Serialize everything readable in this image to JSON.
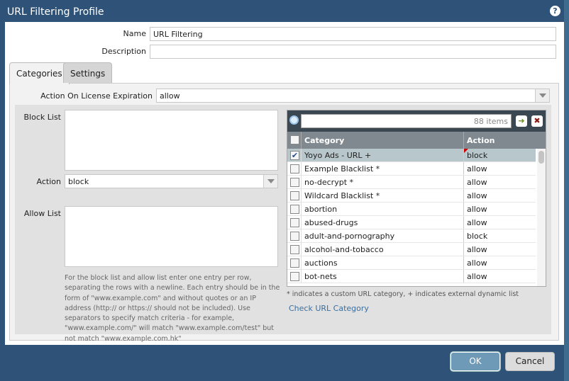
{
  "title": "URL Filtering Profile",
  "form": {
    "name_label": "Name",
    "name_value": "URL Filtering",
    "description_label": "Description",
    "description_value": ""
  },
  "tabs": [
    {
      "label": "Categories"
    },
    {
      "label": "Settings"
    }
  ],
  "license": {
    "label": "Action On License Expiration",
    "value": "allow"
  },
  "block_list": {
    "label": "Block List",
    "value": ""
  },
  "action": {
    "label": "Action",
    "value": "block"
  },
  "allow_list": {
    "label": "Allow List",
    "value": ""
  },
  "help_text": "For the block list and allow list enter one entry per row, separating the rows with a newline. Each entry should be in the form of \"www.example.com\" and without quotes or an IP address (http:// or https:// should not be included). Use separators to specify match criteria - for example, \"www.example.com/\" will match \"www.example.com/test\" but not match \"www.example.com.hk\"",
  "grid": {
    "count": "88 items",
    "col_category": "Category",
    "col_action": "Action",
    "rows": [
      {
        "category": "Yoyo Ads - URL +",
        "action": "block",
        "checked": true
      },
      {
        "category": "Example Blacklist *",
        "action": "allow"
      },
      {
        "category": "no-decrypt *",
        "action": "allow"
      },
      {
        "category": "Wildcard Blacklist *",
        "action": "allow"
      },
      {
        "category": "abortion",
        "action": "allow"
      },
      {
        "category": "abused-drugs",
        "action": "allow"
      },
      {
        "category": "adult-and-pornography",
        "action": "block"
      },
      {
        "category": "alcohol-and-tobacco",
        "action": "allow"
      },
      {
        "category": "auctions",
        "action": "allow"
      },
      {
        "category": "bot-nets",
        "action": "allow"
      }
    ]
  },
  "legend": "* indicates a custom URL category, + indicates external dynamic list",
  "check_link": "Check URL Category",
  "buttons": {
    "ok": "OK",
    "cancel": "Cancel"
  }
}
